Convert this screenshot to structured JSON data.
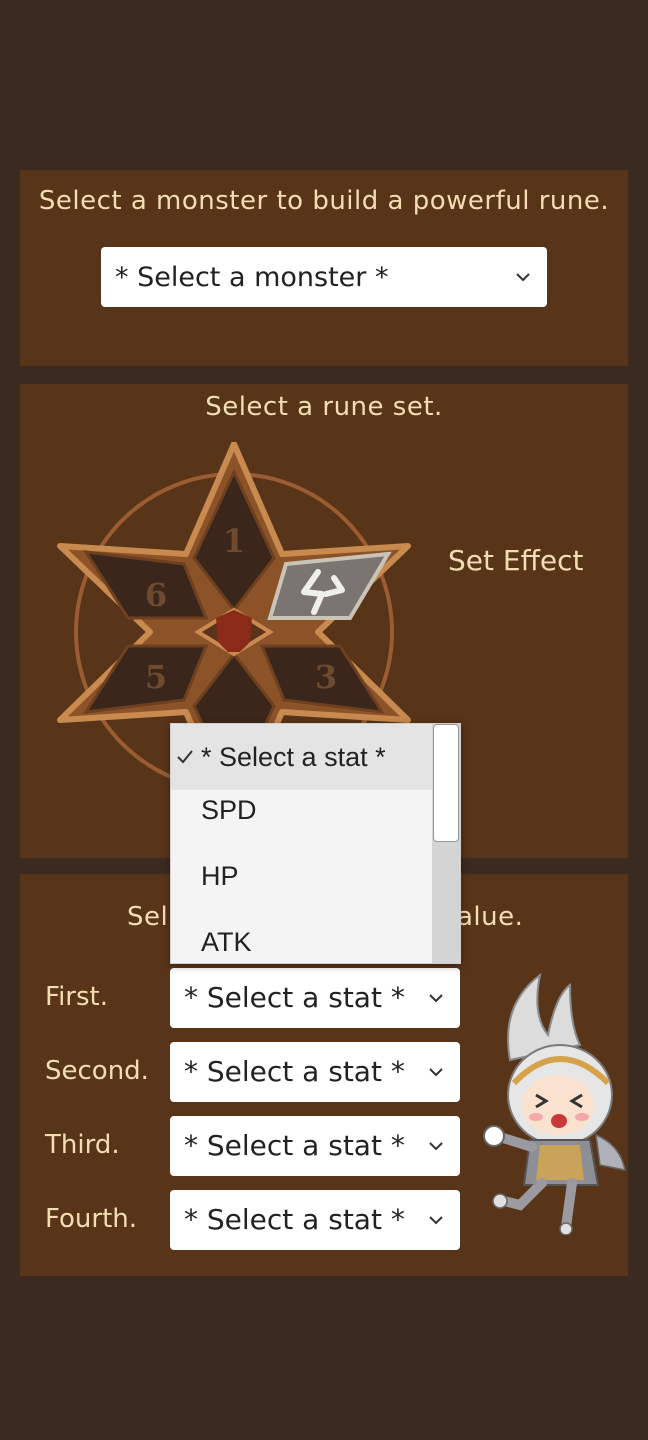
{
  "monster_panel": {
    "heading": "Select a monster to build a powerful rune.",
    "select_value": "* Select a monster *"
  },
  "rune_panel": {
    "heading": "Select a rune set.",
    "set_effect": "Set Effect",
    "slots": [
      "1",
      "6",
      "5",
      "3"
    ]
  },
  "stats_panel": {
    "heading_left": "Sel",
    "heading_right": "alue.",
    "rows": [
      {
        "label": "First.",
        "value": "* Select a stat *"
      },
      {
        "label": "Second.",
        "value": "* Select a stat *"
      },
      {
        "label": "Third.",
        "value": "* Select a stat *"
      },
      {
        "label": "Fourth.",
        "value": "* Select a stat *"
      }
    ]
  },
  "dropdown": {
    "options": [
      "* Select a stat *",
      "SPD",
      "HP",
      "ATK"
    ],
    "selected_index": 0
  },
  "colors": {
    "background": "#3b2a20",
    "panel": "#583419",
    "text": "#f3deb4",
    "rune_bronze": "#b06f3a",
    "rune_dark": "#3a261a"
  },
  "icons": [
    "chevron-down-icon",
    "check-icon",
    "rune-hexagram",
    "lightning-rune-icon",
    "mascot-character"
  ]
}
